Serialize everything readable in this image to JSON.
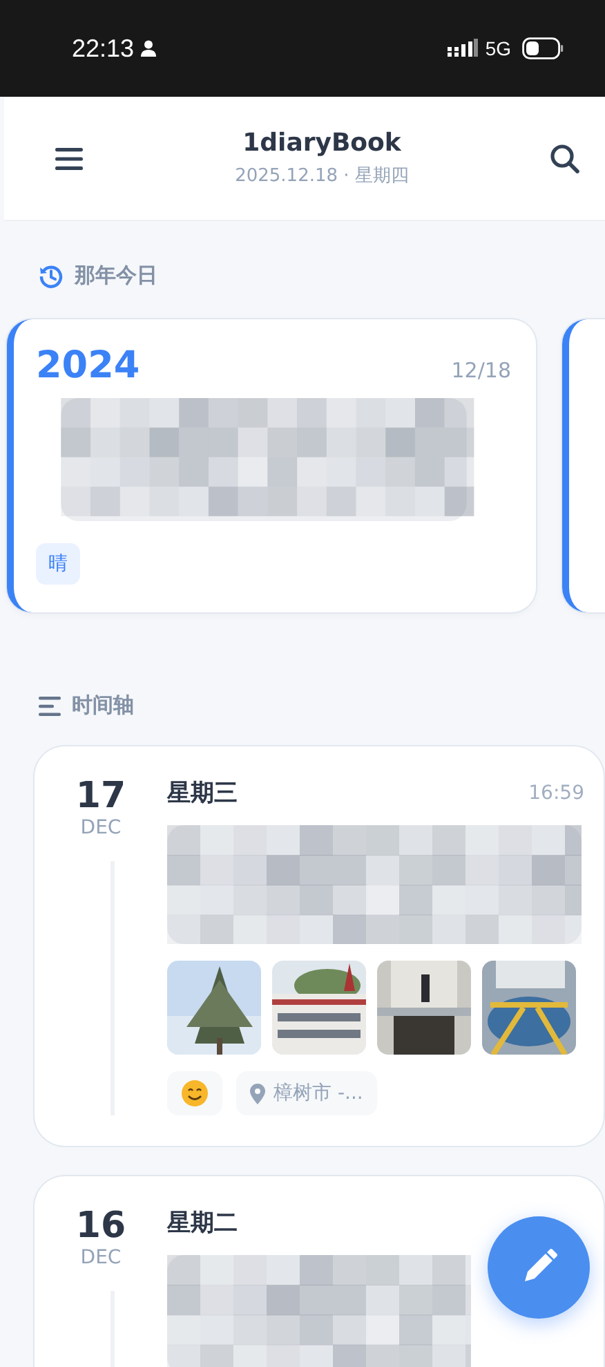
{
  "status_bar": {
    "time": "22:13",
    "network": "5G"
  },
  "header": {
    "title": "1diaryBook",
    "subtitle": "2025.12.18 · 星期四"
  },
  "memories": {
    "title": "那年今日",
    "cards": [
      {
        "year": "2024",
        "date": "12/18",
        "weather": "晴"
      }
    ],
    "has_next": true
  },
  "timeline": {
    "title": "时间轴",
    "entries": [
      {
        "day": "17",
        "month": "DEC",
        "weekday": "星期三",
        "time": "16:59",
        "mood": {
          "kind": "smile"
        },
        "location": "樟树市 -..."
      },
      {
        "day": "16",
        "month": "DEC",
        "weekday": "星期二"
      }
    ]
  }
}
